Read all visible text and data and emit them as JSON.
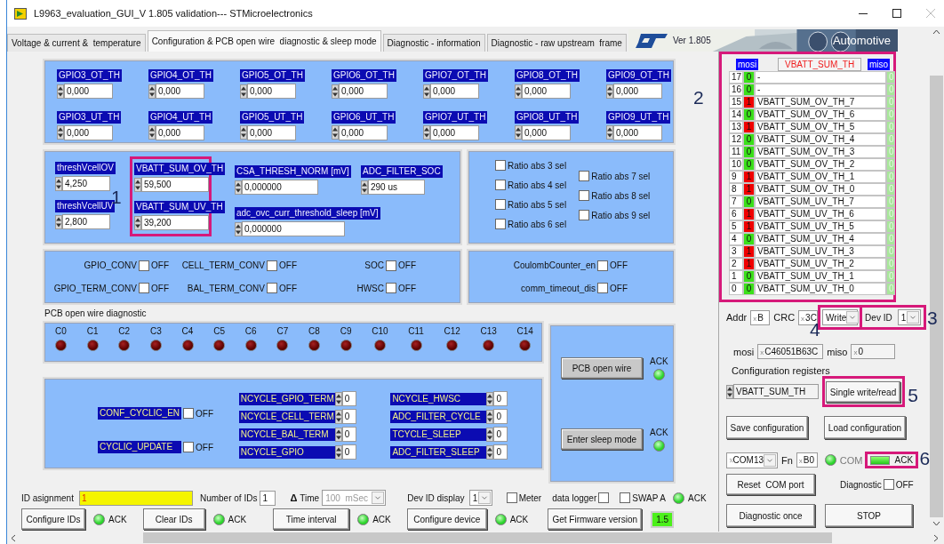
{
  "window": {
    "title": "L9963_evaluation_GUI_V 1.805 validation--- STMicroelectronics"
  },
  "tabs": [
    {
      "label": "Voltage & current &  temperature",
      "selected": false
    },
    {
      "label": "Configuration & PCB open wire  diagnostic & sleep mode",
      "selected": true
    },
    {
      "label": "Diagnostic - information",
      "selected": false
    },
    {
      "label": "Diagnostic - raw upstream  frame",
      "selected": false
    }
  ],
  "banner": {
    "version": "Ver 1.805",
    "caption": "Automotive"
  },
  "gpio_thresholds": [
    [
      {
        "label": "GPIO3_OT_TH",
        "value": "0,000"
      },
      {
        "label": "GPIO4_OT_TH",
        "value": "0,000"
      },
      {
        "label": "GPIO5_OT_TH",
        "value": "0,000"
      },
      {
        "label": "GPIO6_OT_TH",
        "value": "0,000"
      },
      {
        "label": "GPIO7_OT_TH",
        "value": "0,000"
      },
      {
        "label": "GPIO8_OT_TH",
        "value": "0,000"
      },
      {
        "label": "GPIO9_OT_TH",
        "value": "0,000"
      }
    ],
    [
      {
        "label": "GPIO3_UT_TH",
        "value": "0,000"
      },
      {
        "label": "GPIO4_UT_TH",
        "value": "0,000"
      },
      {
        "label": "GPIO5_UT_TH",
        "value": "0,000"
      },
      {
        "label": "GPIO6_UT_TH",
        "value": "0,000"
      },
      {
        "label": "GPIO7_UT_TH",
        "value": "0,000"
      },
      {
        "label": "GPIO8_UT_TH",
        "value": "0,000"
      },
      {
        "label": "GPIO9_UT_TH",
        "value": "0,000"
      }
    ]
  ],
  "threshold_columns": [
    {
      "fields": [
        {
          "label": "threshVcellOV",
          "value": "4,250"
        },
        {
          "label": "threshVcellUV",
          "value": "2,800"
        }
      ]
    },
    {
      "annotation": "1",
      "fields": [
        {
          "label": "VBATT_SUM_OV_TH",
          "value": "59,500"
        },
        {
          "label": "VBATT_SUM_UV_TH",
          "value": "39,200"
        }
      ]
    },
    {
      "fields": [
        {
          "label": "CSA_THRESH_NORM [mV]",
          "value": "0,000000"
        },
        {
          "label": "adc_ovc_curr_threshold_sleep [mV]",
          "value": "0,000000"
        }
      ]
    },
    {
      "fields": [
        {
          "label": "ADC_FILTER_SOC",
          "value": "290 us"
        }
      ]
    }
  ],
  "ratio_columns": [
    [
      {
        "label": "Ratio abs 3 sel",
        "checked": false
      },
      {
        "label": "Ratio abs 4 sel",
        "checked": false
      },
      {
        "label": "Ratio abs 5 sel",
        "checked": false
      },
      {
        "label": "Ratio abs 6 sel",
        "checked": false
      }
    ],
    [
      {
        "label": "Ratio abs 7 sel",
        "checked": false
      },
      {
        "label": "Ratio abs 8 sel",
        "checked": false
      },
      {
        "label": "Ratio abs 9 sel",
        "checked": false
      }
    ]
  ],
  "conversion_flags": [
    {
      "label": "GPIO_CONV",
      "checked": false,
      "state_text": "OFF"
    },
    {
      "label": "CELL_TERM_CONV",
      "checked": false,
      "state_text": "OFF"
    },
    {
      "label": "SOC",
      "checked": false,
      "state_text": "OFF"
    },
    {
      "label": "GPIO_TERM_CONV",
      "checked": false,
      "state_text": "OFF"
    },
    {
      "label": "BAL_TERM_CONV",
      "checked": false,
      "state_text": "OFF"
    },
    {
      "label": "HWSC",
      "checked": false,
      "state_text": "OFF"
    }
  ],
  "coulomb_flags": [
    {
      "label": "CoulombCounter_en",
      "checked": false,
      "state_text": "OFF"
    },
    {
      "label": "comm_timeout_dis",
      "checked": false,
      "state_text": "OFF"
    }
  ],
  "open_wire": {
    "title": "PCB open wire diagnostic",
    "channels": [
      {
        "label": "C0",
        "on": false
      },
      {
        "label": "C1",
        "on": false
      },
      {
        "label": "C2",
        "on": false
      },
      {
        "label": "C3",
        "on": false
      },
      {
        "label": "C4",
        "on": false
      },
      {
        "label": "C5",
        "on": false
      },
      {
        "label": "C6",
        "on": false
      },
      {
        "label": "C7",
        "on": false
      },
      {
        "label": "C8",
        "on": false
      },
      {
        "label": "C9",
        "on": false
      },
      {
        "label": "C10",
        "on": false
      },
      {
        "label": "C11",
        "on": false
      },
      {
        "label": "C12",
        "on": false
      },
      {
        "label": "C13",
        "on": false
      },
      {
        "label": "C14",
        "on": false
      }
    ]
  },
  "cyclic": {
    "flags": [
      {
        "label": "CONF_CYCLIC_EN",
        "checked": false,
        "state_text": "OFF"
      },
      {
        "label": "CYCLIC_UPDATE",
        "checked": false,
        "state_text": "OFF"
      }
    ],
    "counter_columns": [
      [
        {
          "label": "NCYCLE_GPIO_TERM",
          "value": "0"
        },
        {
          "label": "NCYCLE_CELL_TERM",
          "value": "0"
        },
        {
          "label": "NCYCLE_BAL_TERM",
          "value": "0"
        },
        {
          "label": "NCYCLE_GPIO",
          "value": "0"
        }
      ],
      [
        {
          "label": "NCYCLE_HWSC",
          "value": "0"
        },
        {
          "label": "ADC_FILTER_CYCLE",
          "value": "0"
        },
        {
          "label": "TCYCLE_SLEEP",
          "value": "0"
        },
        {
          "label": "ADC_FILTER_SLEEP",
          "value": "0"
        }
      ]
    ]
  },
  "actions": [
    {
      "label": "PCB open wire",
      "ack": "ACK",
      "ack_on": true
    },
    {
      "label": "Enter sleep mode",
      "ack": "ACK",
      "ack_on": true
    }
  ],
  "register": {
    "annotation": "2",
    "mosi_label": "mosi",
    "name": "VBATT_SUM_TH",
    "miso_label": "miso",
    "bits": [
      {
        "index": "17",
        "mosi": "0",
        "on": false,
        "name": "-",
        "miso": "0"
      },
      {
        "index": "16",
        "mosi": "0",
        "on": false,
        "name": "-",
        "miso": "0"
      },
      {
        "index": "15",
        "mosi": "1",
        "on": true,
        "name": "VBATT_SUM_OV_TH_7",
        "miso": "0"
      },
      {
        "index": "14",
        "mosi": "0",
        "on": false,
        "name": "VBATT_SUM_OV_TH_6",
        "miso": "0"
      },
      {
        "index": "13",
        "mosi": "1",
        "on": true,
        "name": "VBATT_SUM_OV_TH_5",
        "miso": "0"
      },
      {
        "index": "12",
        "mosi": "0",
        "on": false,
        "name": "VBATT_SUM_OV_TH_4",
        "miso": "0"
      },
      {
        "index": "11",
        "mosi": "0",
        "on": false,
        "name": "VBATT_SUM_OV_TH_3",
        "miso": "0"
      },
      {
        "index": "10",
        "mosi": "0",
        "on": false,
        "name": "VBATT_SUM_OV_TH_2",
        "miso": "0"
      },
      {
        "index": "9",
        "mosi": "1",
        "on": true,
        "name": "VBATT_SUM_OV_TH_1",
        "miso": "0"
      },
      {
        "index": "8",
        "mosi": "1",
        "on": true,
        "name": "VBATT_SUM_OV_TH_0",
        "miso": "0"
      },
      {
        "index": "7",
        "mosi": "0",
        "on": false,
        "name": "VBATT_SUM_UV_TH_7",
        "miso": "0"
      },
      {
        "index": "6",
        "mosi": "1",
        "on": true,
        "name": "VBATT_SUM_UV_TH_6",
        "miso": "0"
      },
      {
        "index": "5",
        "mosi": "1",
        "on": true,
        "name": "VBATT_SUM_UV_TH_5",
        "miso": "0"
      },
      {
        "index": "4",
        "mosi": "0",
        "on": false,
        "name": "VBATT_SUM_UV_TH_4",
        "miso": "0"
      },
      {
        "index": "3",
        "mosi": "1",
        "on": true,
        "name": "VBATT_SUM_UV_TH_3",
        "miso": "0"
      },
      {
        "index": "2",
        "mosi": "1",
        "on": true,
        "name": "VBATT_SUM_UV_TH_2",
        "miso": "0"
      },
      {
        "index": "1",
        "mosi": "0",
        "on": false,
        "name": "VBATT_SUM_UV_TH_1",
        "miso": "0"
      },
      {
        "index": "0",
        "mosi": "0",
        "on": false,
        "name": "VBATT_SUM_UV_TH_0",
        "miso": "0"
      }
    ]
  },
  "frame": {
    "addr_label": "Addr",
    "addr_radix": "x",
    "addr": "B",
    "crc_label": "CRC",
    "crc_radix": "x",
    "crc": "3C",
    "mode": {
      "value": "Write",
      "annotation": "4"
    },
    "dev_id": {
      "label": "Dev ID",
      "value": "1",
      "annotation": "3"
    }
  },
  "spi": {
    "mosi_label": "mosi",
    "mosi_radix": "x",
    "mosi": "C46051B63C",
    "miso_label": "miso",
    "miso_radix": "x",
    "miso": "0"
  },
  "config": {
    "label": "Configuration registers",
    "value": "VBATT_SUM_TH",
    "button": "Single write/read",
    "annotation": "5"
  },
  "file_buttons": [
    "Save configuration",
    "Load configuration"
  ],
  "com": {
    "port": "COM13",
    "fn_label": "Fn",
    "fn_radix": "x",
    "fn": "B0",
    "led_on": true,
    "label": "COM",
    "link_on": true,
    "ack": "ACK",
    "annotation": "6"
  },
  "reset_button": "Reset  COM port",
  "diagnostic": {
    "label": "Diagnostic",
    "checked": false,
    "state_text": "OFF"
  },
  "right_buttons": [
    "Diagnostic once",
    "STOP"
  ],
  "bottom": {
    "id_label": "ID asignment",
    "id_value": "1",
    "count_label": "Number of IDs",
    "count": "1",
    "delta": "Δ",
    "time_label": "Time",
    "time_value": "100  mSec",
    "time_disabled": true,
    "dev_display_label": "Dev ID display",
    "dev_display": "1",
    "checks": [
      {
        "label": "Meter",
        "checked": false,
        "kind": "box-left"
      },
      {
        "label": "data logger",
        "checked": false,
        "kind": "box-right"
      },
      {
        "label": "SWAP A",
        "checked": false,
        "kind": "box-left"
      }
    ],
    "ack": "ACK",
    "ack_on": true,
    "buttons": [
      {
        "label": "Configure IDs",
        "ack": "ACK",
        "ack_on": true
      },
      {
        "label": "Clear IDs",
        "ack": "ACK",
        "ack_on": true
      },
      {
        "label": "Time interval",
        "ack": "ACK",
        "ack_on": true
      },
      {
        "label": "Configure device",
        "ack": "ACK",
        "ack_on": true
      }
    ],
    "firmware_button": "Get Firmware version",
    "firmware": "1.5"
  }
}
